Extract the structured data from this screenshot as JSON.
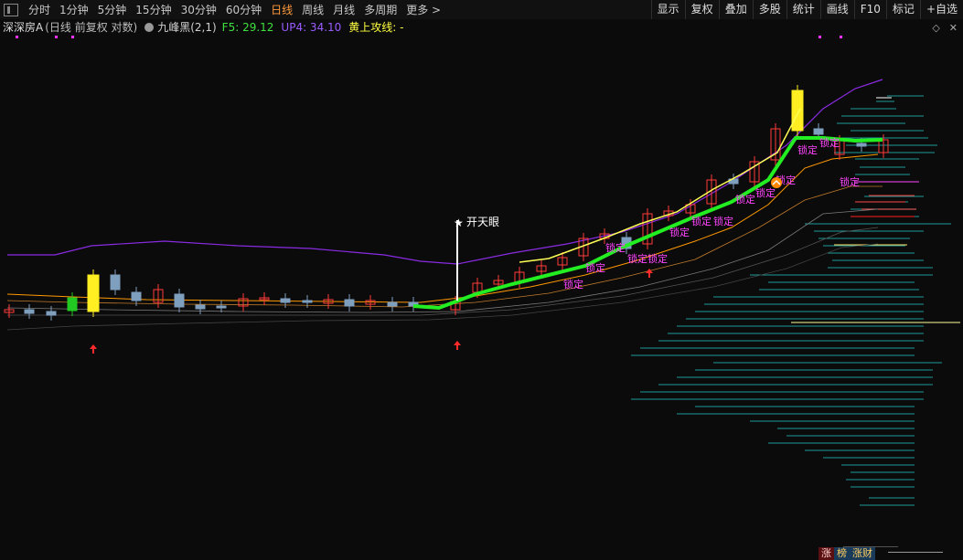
{
  "toolbar": {
    "periods": [
      "分时",
      "1分钟",
      "5分钟",
      "15分钟",
      "30分钟",
      "60分钟",
      "日线",
      "周线",
      "月线",
      "多周期",
      "更多 >"
    ],
    "active_period": "日线",
    "right_menu": [
      "显示",
      "复权",
      "叠加",
      "多股",
      "统计",
      "画线",
      "F10",
      "标记",
      "+自选"
    ]
  },
  "info": {
    "stock_title": "深深房A",
    "mode": "(日线 前复权 对数)",
    "indicator_name": "九峰黑(2,1)",
    "f5": "F5: 29.12",
    "up4": "UP4: 34.10",
    "yellow_label": "黄上攻线: -"
  },
  "chart": {
    "signal_label": "开天眼",
    "lock_label": "锁定",
    "colors": {
      "up_candle": "#ff3b3b",
      "down_candle": "#7f9fbf",
      "green_line": "#22ee22",
      "yellow_line": "#ffff55",
      "purple_line": "#8a2be2",
      "orange_line": "#ff9900",
      "volume_profile": "#1f9b9b",
      "lock_text": "#ff44ff"
    }
  },
  "bottom_tags": [
    "涨",
    "榜",
    "涨财"
  ]
}
